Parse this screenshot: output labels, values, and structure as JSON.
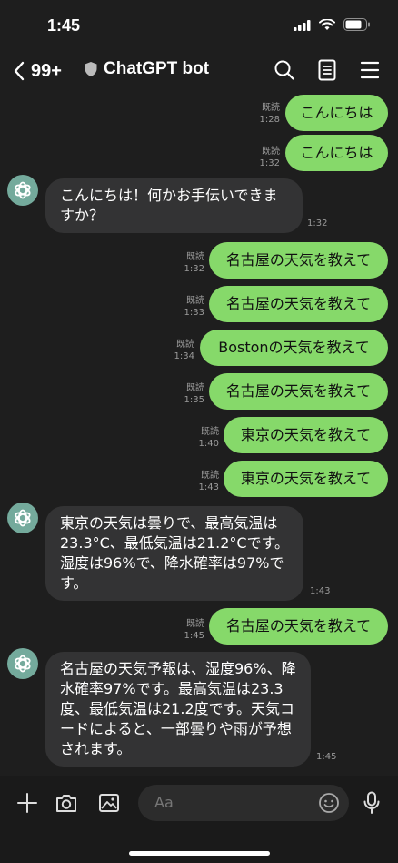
{
  "status_bar": {
    "time": "1:45"
  },
  "header": {
    "back_count": "99+",
    "title": "ChatGPT bot"
  },
  "messages": {
    "m1": {
      "text": "こんにちは",
      "read": "既読",
      "time": "1:28"
    },
    "m2": {
      "text": "こんにちは",
      "read": "既読",
      "time": "1:32"
    },
    "m3": {
      "text": "こんにちは！何かお手伝いできますか？",
      "time": "1:32"
    },
    "m4": {
      "text": "名古屋の天気を教えて",
      "read": "既読",
      "time": "1:32"
    },
    "m5": {
      "text": "名古屋の天気を教えて",
      "read": "既読",
      "time": "1:33"
    },
    "m6": {
      "text": "Bostonの天気を教えて",
      "read": "既読",
      "time": "1:34"
    },
    "m7": {
      "text": "名古屋の天気を教えて",
      "read": "既読",
      "time": "1:35"
    },
    "m8": {
      "text": "東京の天気を教えて",
      "read": "既読",
      "time": "1:40"
    },
    "m9": {
      "text": "東京の天気を教えて",
      "read": "既読",
      "time": "1:43"
    },
    "m10": {
      "text": "東京の天気は曇りで、最高気温は23.3°C、最低気温は21.2°Cです。湿度は96%で、降水確率は97%です。",
      "time": "1:43"
    },
    "m11": {
      "text": "名古屋の天気を教えて",
      "read": "既読",
      "time": "1:45"
    },
    "m12": {
      "text": "名古屋の天気予報は、湿度96%、降水確率97%です。最高気温は23.3度、最低気温は21.2度です。天気コードによると、一部曇りや雨が予想されます。",
      "time": "1:45"
    }
  },
  "input": {
    "placeholder": "Aa"
  },
  "colors": {
    "outgoing_bubble": "#86d96a",
    "incoming_bubble": "#333334",
    "background": "#1e1e1e",
    "avatar": "#74aa9c"
  }
}
